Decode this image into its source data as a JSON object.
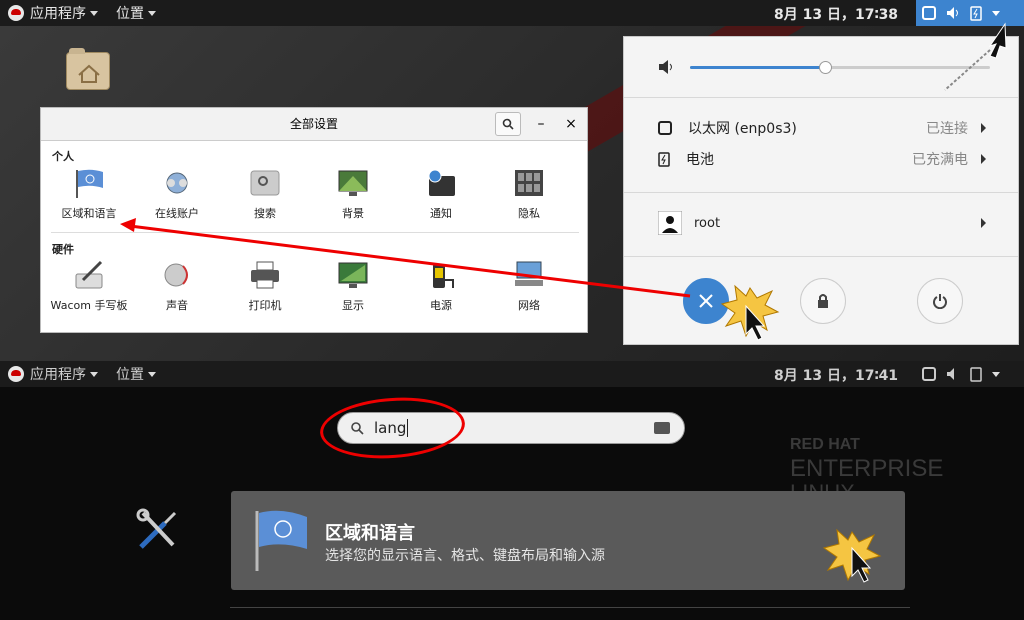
{
  "topbar": {
    "applications": "应用程序",
    "places": "位置",
    "clock_top": "8月 13 日，17∶38",
    "clock_bottom": "8月 13 日，17∶41"
  },
  "settings_window": {
    "title": "全部设置",
    "minimize": "–",
    "close": "×",
    "personal_label": "个人",
    "hardware_label": "硬件",
    "personal_items": [
      {
        "label": "区域和语言"
      },
      {
        "label": "在线账户"
      },
      {
        "label": "搜索"
      },
      {
        "label": "背景"
      },
      {
        "label": "通知"
      },
      {
        "label": "隐私"
      }
    ],
    "hardware_items": [
      {
        "label": "Wacom 手写板"
      },
      {
        "label": "声音"
      },
      {
        "label": "打印机"
      },
      {
        "label": "显示"
      },
      {
        "label": "电源"
      },
      {
        "label": "网络"
      }
    ]
  },
  "system_menu": {
    "volume_level": 0.45,
    "network": {
      "label": "以太网 (enp0s3)",
      "status": "已连接"
    },
    "battery": {
      "label": "电池",
      "status": "已充满电"
    },
    "user": {
      "label": "root"
    }
  },
  "overview": {
    "search_value": "lang",
    "brand": {
      "line1": "RED HAT",
      "line2": "ENTERPRISE",
      "line3": "LINUX"
    },
    "result": {
      "title": "区域和语言",
      "description": "选择您的显示语言、格式、键盘布局和输入源"
    }
  },
  "colors": {
    "accent": "#3d84cf",
    "annotation_red": "#ee0000",
    "result_bg": "#5a5a5a"
  }
}
